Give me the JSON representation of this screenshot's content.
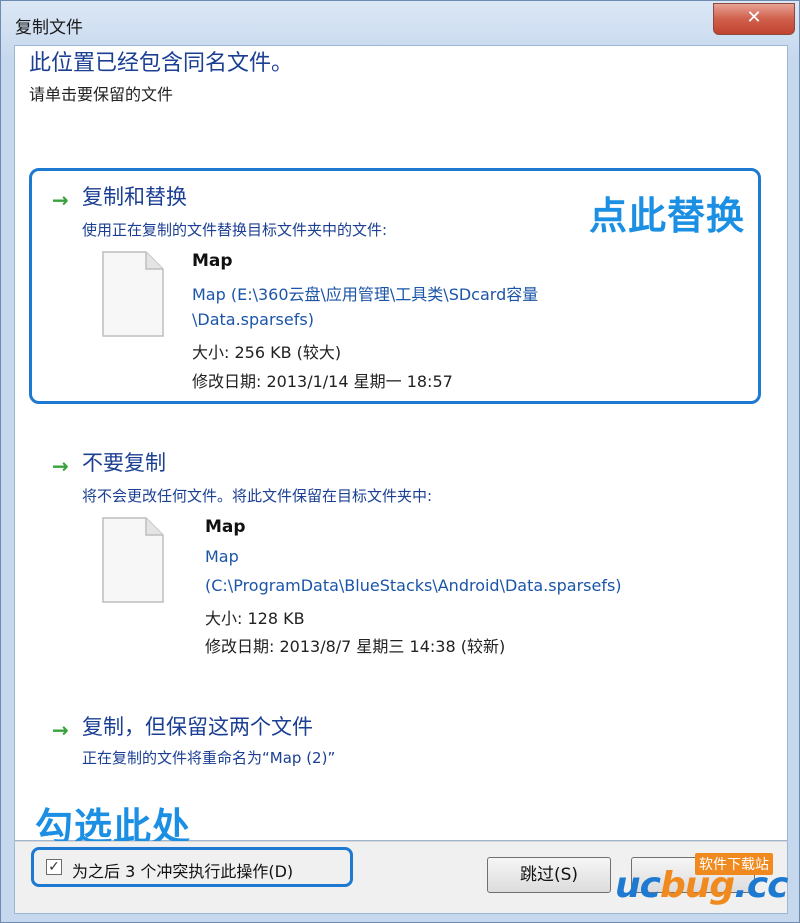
{
  "window": {
    "title": "复制文件",
    "close_glyph": "✕"
  },
  "heading": "此位置已经包含同名文件。",
  "subheading": "请单击要保留的文件",
  "options": [
    {
      "title": "复制和替换",
      "description": "使用正在复制的文件替换目标文件夹中的文件:",
      "file": {
        "name": "Map",
        "path_line1": "Map (E:\\360云盘\\应用管理\\工具类\\SDcard容量",
        "path_line2": "\\Data.sparsefs)",
        "size": "大小: 256 KB (较大)",
        "modified": "修改日期: 2013/1/14 星期一 18:57"
      }
    },
    {
      "title": "不要复制",
      "description": "将不会更改任何文件。将此文件保留在目标文件夹中:",
      "file": {
        "name": "Map",
        "path_line1": "Map",
        "path_line2": "(C:\\ProgramData\\BlueStacks\\Android\\Data.sparsefs)",
        "size": "大小: 128 KB",
        "modified": "修改日期: 2013/8/7 星期三 14:38 (较新)"
      }
    },
    {
      "title": "复制，但保留这两个文件",
      "description": "正在复制的文件将重命名为“Map (2)”"
    }
  ],
  "annotations": {
    "replace": "点此替换",
    "check": "勾选此处"
  },
  "footer": {
    "checkbox_label": "为之后 3 个冲突执行此操作(D)",
    "checkbox_checked": true,
    "skip_button": "跳过(S)"
  },
  "watermark": {
    "small": "软件下载站",
    "uc": "uc",
    "bug": "bug",
    "cc": ".cc"
  },
  "icons": {
    "arrow": "→",
    "check": "✓"
  },
  "colors": {
    "accent": "#1e7ad1",
    "link": "#1b3f93",
    "arrow": "#39a33b"
  }
}
